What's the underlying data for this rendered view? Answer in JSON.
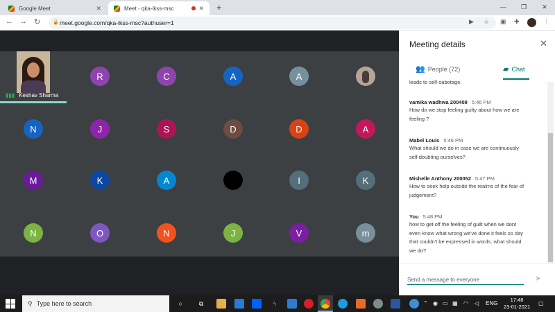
{
  "browser": {
    "tabs": [
      {
        "title": "Google Meet"
      },
      {
        "title": "Meet - qka-ikss-msc"
      }
    ],
    "url": "meet.google.com/qka-ikss-msc?authuser=1"
  },
  "grid": {
    "self": {
      "name": "Keshav Sharma"
    },
    "participants": [
      {
        "letter": "",
        "color": "",
        "kind": "self"
      },
      {
        "letter": "R",
        "color": "#8e44ad"
      },
      {
        "letter": "C",
        "color": "#8e44ad"
      },
      {
        "letter": "A",
        "color": "#1565c0"
      },
      {
        "letter": "A",
        "color": "#78909c"
      },
      {
        "letter": "",
        "color": "#b4a598",
        "kind": "photo"
      },
      {
        "letter": "N",
        "color": "#1565c0"
      },
      {
        "letter": "J",
        "color": "#8e24aa"
      },
      {
        "letter": "S",
        "color": "#ad1457"
      },
      {
        "letter": "D",
        "color": "#6d4c41"
      },
      {
        "letter": "D",
        "color": "#d84315"
      },
      {
        "letter": "A",
        "color": "#c2185b"
      },
      {
        "letter": "M",
        "color": "#6a1b9a"
      },
      {
        "letter": "K",
        "color": "#0d47a1"
      },
      {
        "letter": "A",
        "color": "#0288d1"
      },
      {
        "letter": "",
        "color": "#000000"
      },
      {
        "letter": "I",
        "color": "#546e7a"
      },
      {
        "letter": "K",
        "color": "#546e7a"
      },
      {
        "letter": "N",
        "color": "#7cb342"
      },
      {
        "letter": "O",
        "color": "#7e57c2"
      },
      {
        "letter": "N",
        "color": "#f4511e"
      },
      {
        "letter": "J",
        "color": "#7cb342"
      },
      {
        "letter": "V",
        "color": "#7b1fa2"
      },
      {
        "letter": "m",
        "color": "#78909c"
      }
    ]
  },
  "panel": {
    "title": "Meeting details",
    "people_tab": "People (72)",
    "chat_tab": "Chat",
    "fragment": "leads to self-sabotage.",
    "messages": [
      {
        "sender": "vamika wadhwa 200408",
        "time": "5:46 PM",
        "lines": [
          "How do we stop feeling guilty about how we are",
          "feeling ?"
        ]
      },
      {
        "sender": "Mabel Louis",
        "time": "5:46 PM",
        "lines": [
          "What should we do in case we are continuously",
          "self doubting ourselves?"
        ]
      },
      {
        "sender": "Mishelle Anthony 200052",
        "time": "5:47 PM",
        "lines": [
          "How to seek help outside the realms of the fear of",
          "judgement?"
        ]
      },
      {
        "sender": "You",
        "time": "5:48 PM",
        "lines": [
          "how to get off the feeling of guilt when we dont",
          "even know what wrong we've done it feels so day",
          "that couldn't be expressed in words. what should",
          "we do?"
        ]
      }
    ],
    "input_placeholder": "Send a message to everyone"
  },
  "taskbar": {
    "search_placeholder": "Type here to search",
    "language": "ENG",
    "time": "17:48",
    "date": "23-01-2021"
  }
}
